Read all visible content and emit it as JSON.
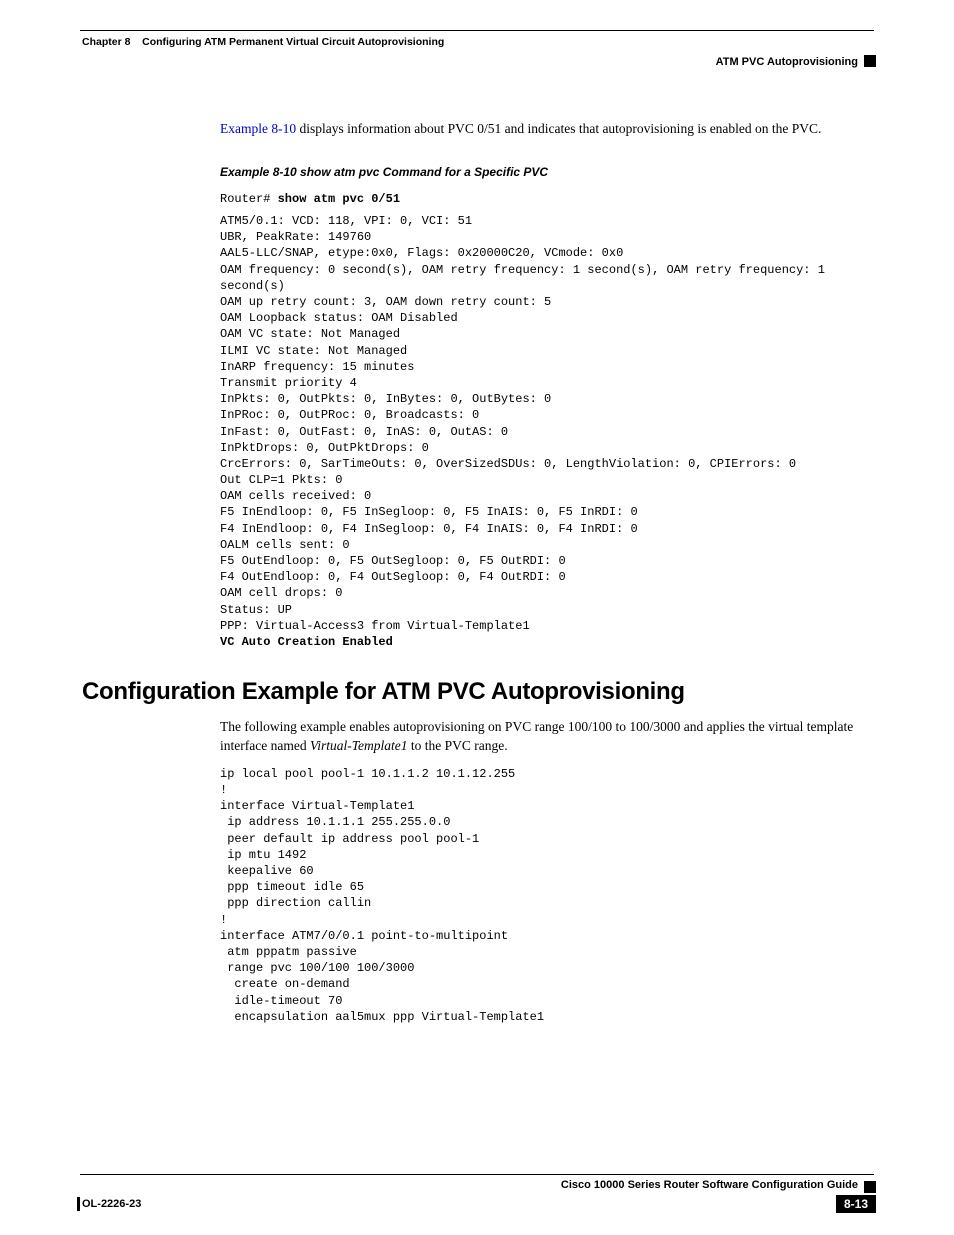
{
  "header": {
    "chapter_label": "Chapter 8",
    "chapter_title": "Configuring ATM Permanent Virtual Circuit Autoprovisioning",
    "section_right": "ATM PVC Autoprovisioning"
  },
  "intro": {
    "link_text": "Example 8-10",
    "para_rest": " displays information about PVC 0/51 and indicates that autoprovisioning is enabled on the PVC."
  },
  "example_caption": "Example 8-10   show atm pvc Command for a Specific PVC",
  "router_prompt": "Router# ",
  "router_cmd": "show atm pvc 0/51",
  "cli_output": "ATM5/0.1: VCD: 118, VPI: 0, VCI: 51\nUBR, PeakRate: 149760\nAAL5-LLC/SNAP, etype:0x0, Flags: 0x20000C20, VCmode: 0x0\nOAM frequency: 0 second(s), OAM retry frequency: 1 second(s), OAM retry frequency: 1 \nsecond(s)\nOAM up retry count: 3, OAM down retry count: 5\nOAM Loopback status: OAM Disabled\nOAM VC state: Not Managed\nILMI VC state: Not Managed\nInARP frequency: 15 minutes\nTransmit priority 4\nInPkts: 0, OutPkts: 0, InBytes: 0, OutBytes: 0\nInPRoc: 0, OutPRoc: 0, Broadcasts: 0\nInFast: 0, OutFast: 0, InAS: 0, OutAS: 0\nInPktDrops: 0, OutPktDrops: 0\nCrcErrors: 0, SarTimeOuts: 0, OverSizedSDUs: 0, LengthViolation: 0, CPIErrors: 0\nOut CLP=1 Pkts: 0\nOAM cells received: 0\nF5 InEndloop: 0, F5 InSegloop: 0, F5 InAIS: 0, F5 InRDI: 0\nF4 InEndloop: 0, F4 InSegloop: 0, F4 InAIS: 0, F4 InRDI: 0\nOALM cells sent: 0\nF5 OutEndloop: 0, F5 OutSegloop: 0, F5 OutRDI: 0\nF4 OutEndloop: 0, F4 OutSegloop: 0, F4 OutRDI: 0\nOAM cell drops: 0\nStatus: UP\nPPP: Virtual-Access3 from Virtual-Template1",
  "cli_output_bold": "VC Auto Creation Enabled",
  "section2": {
    "heading": "Configuration Example for ATM PVC Autoprovisioning",
    "para_start": "The following example enables autoprovisioning on PVC range 100/100 to 100/3000 and applies the virtual template interface named ",
    "para_italic": "Virtual-Template1",
    "para_end": " to the PVC range.",
    "config": "ip local pool pool-1 10.1.1.2 10.1.12.255\n!\ninterface Virtual-Template1\n ip address 10.1.1.1 255.255.0.0\n peer default ip address pool pool-1\n ip mtu 1492\n keepalive 60\n ppp timeout idle 65\n ppp direction callin\n!\ninterface ATM7/0/0.1 point-to-multipoint\n atm pppatm passive\n range pvc 100/100 100/3000\n  create on-demand\n  idle-timeout 70\n  encapsulation aal5mux ppp Virtual-Template1"
  },
  "footer": {
    "guide_title": "Cisco 10000 Series Router Software Configuration Guide",
    "doc_id": "OL-2226-23",
    "page": "8-13"
  }
}
